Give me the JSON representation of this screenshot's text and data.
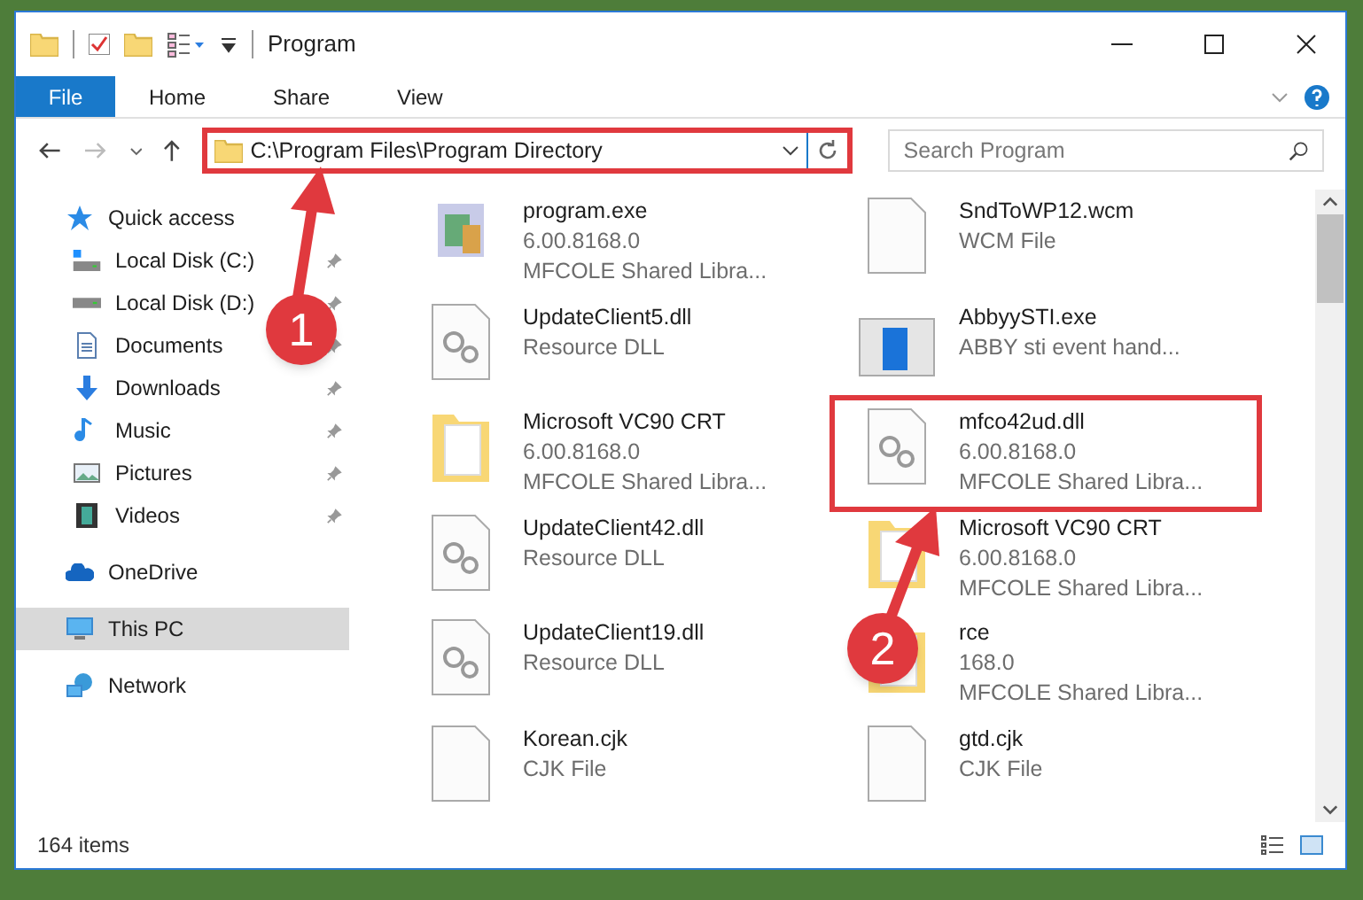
{
  "window": {
    "title": "Program"
  },
  "ribbon": {
    "tabs": [
      {
        "label": "File",
        "selected": true
      },
      {
        "label": "Home",
        "selected": false
      },
      {
        "label": "Share",
        "selected": false
      },
      {
        "label": "View",
        "selected": false
      }
    ]
  },
  "address_bar": {
    "path": "C:\\Program Files\\Program Directory",
    "highlighted": true
  },
  "search": {
    "placeholder": "Search Program"
  },
  "sidebar": {
    "items": [
      {
        "label": "Quick access",
        "kind": "quick",
        "selected": false,
        "children": [
          {
            "label": "Local Disk (C:)",
            "kind": "diskc",
            "pinned": true,
            "selected": false
          },
          {
            "label": "Local Disk (D:)",
            "kind": "disk",
            "pinned": true,
            "selected": false
          },
          {
            "label": "Documents",
            "kind": "docs",
            "pinned": true,
            "selected": false
          },
          {
            "label": "Downloads",
            "kind": "downloads",
            "pinned": true,
            "selected": false
          },
          {
            "label": "Music",
            "kind": "music",
            "pinned": true,
            "selected": false
          },
          {
            "label": "Pictures",
            "kind": "pictures",
            "pinned": true,
            "selected": false
          },
          {
            "label": "Videos",
            "kind": "videos",
            "pinned": true,
            "selected": false
          }
        ]
      },
      {
        "label": "OneDrive",
        "kind": "cloud",
        "selected": false
      },
      {
        "label": "This PC",
        "kind": "pc",
        "selected": true
      },
      {
        "label": "Network",
        "kind": "network",
        "selected": false
      }
    ]
  },
  "files": {
    "columns": [
      [
        {
          "name": "program.exe",
          "lines": [
            "6.00.8168.0",
            "MFCOLE Shared Libra..."
          ],
          "kind": "exe",
          "highlighted": false
        },
        {
          "name": "UpdateClient5.dll",
          "lines": [
            "Resource DLL"
          ],
          "kind": "dll",
          "highlighted": false
        },
        {
          "name": "Microsoft VC90 CRT",
          "lines": [
            "6.00.8168.0",
            "MFCOLE Shared Libra..."
          ],
          "kind": "folder",
          "highlighted": false
        },
        {
          "name": "UpdateClient42.dll",
          "lines": [
            "Resource DLL"
          ],
          "kind": "dll",
          "highlighted": false
        },
        {
          "name": "UpdateClient19.dll",
          "lines": [
            "Resource DLL"
          ],
          "kind": "dll",
          "highlighted": false
        },
        {
          "name": "Korean.cjk",
          "lines": [
            "CJK File"
          ],
          "kind": "file",
          "highlighted": false
        }
      ],
      [
        {
          "name": "SndToWP12.wcm",
          "lines": [
            "WCM File"
          ],
          "kind": "file",
          "highlighted": false
        },
        {
          "name": "AbbyySTI.exe",
          "lines": [
            "ABBY sti event hand..."
          ],
          "kind": "app",
          "highlighted": false
        },
        {
          "name": "mfco42ud.dll",
          "lines": [
            "6.00.8168.0",
            "MFCOLE Shared Libra..."
          ],
          "kind": "dll",
          "highlighted": true
        },
        {
          "name": "Microsoft VC90 CRT",
          "lines": [
            "6.00.8168.0",
            "MFCOLE Shared Libra..."
          ],
          "kind": "folder",
          "highlighted": false
        },
        {
          "name": "rce",
          "lines": [
            "168.0",
            "MFCOLE Shared Libra..."
          ],
          "kind": "folder",
          "highlighted": false
        },
        {
          "name": "gtd.cjk",
          "lines": [
            "CJK File"
          ],
          "kind": "file",
          "highlighted": false
        }
      ]
    ]
  },
  "status_bar": {
    "count": "164 items"
  },
  "annotations": [
    {
      "label": "1"
    },
    {
      "label": "2"
    }
  ]
}
